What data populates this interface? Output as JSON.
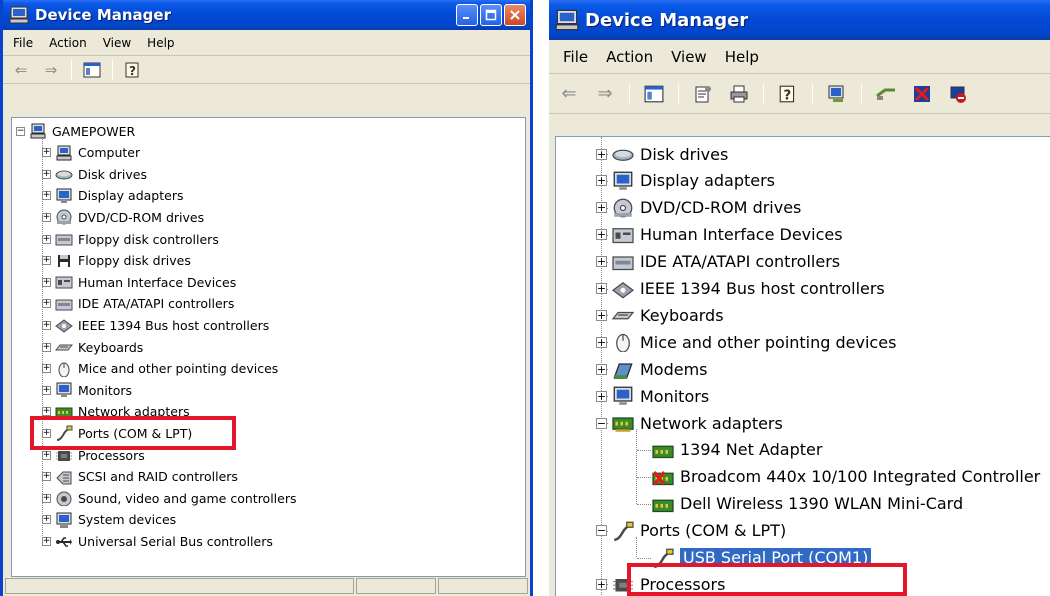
{
  "left_window": {
    "title": "Device Manager",
    "menu": [
      "File",
      "Action",
      "View",
      "Help"
    ],
    "root": "GAMEPOWER",
    "items": [
      {
        "label": "Computer",
        "icon": "computer-icon"
      },
      {
        "label": "Disk drives",
        "icon": "disk-drive-icon"
      },
      {
        "label": "Display adapters",
        "icon": "monitor-icon"
      },
      {
        "label": "DVD/CD-ROM drives",
        "icon": "cd-rom-icon"
      },
      {
        "label": "Floppy disk controllers",
        "icon": "floppy-controller-icon"
      },
      {
        "label": "Floppy disk drives",
        "icon": "floppy-drive-icon"
      },
      {
        "label": "Human Interface Devices",
        "icon": "hid-icon"
      },
      {
        "label": "IDE ATA/ATAPI controllers",
        "icon": "ide-controller-icon"
      },
      {
        "label": "IEEE 1394 Bus host controllers",
        "icon": "ieee1394-icon"
      },
      {
        "label": "Keyboards",
        "icon": "keyboard-icon"
      },
      {
        "label": "Mice and other pointing devices",
        "icon": "mouse-icon"
      },
      {
        "label": "Monitors",
        "icon": "monitor-icon"
      },
      {
        "label": "Network adapters",
        "icon": "network-adapter-icon"
      },
      {
        "label": "Ports (COM & LPT)",
        "icon": "port-icon"
      },
      {
        "label": "Processors",
        "icon": "processor-icon"
      },
      {
        "label": "SCSI and RAID controllers",
        "icon": "scsi-icon"
      },
      {
        "label": "Sound, video and game controllers",
        "icon": "sound-icon"
      },
      {
        "label": "System devices",
        "icon": "system-device-icon"
      },
      {
        "label": "Universal Serial Bus controllers",
        "icon": "usb-icon"
      }
    ]
  },
  "right_window": {
    "title": "Device Manager",
    "menu": [
      "File",
      "Action",
      "View",
      "Help"
    ],
    "items": [
      {
        "label": "Disk drives",
        "icon": "disk-drive-icon",
        "expanded": false
      },
      {
        "label": "Display adapters",
        "icon": "monitor-icon",
        "expanded": false
      },
      {
        "label": "DVD/CD-ROM drives",
        "icon": "cd-rom-icon",
        "expanded": false
      },
      {
        "label": "Human Interface Devices",
        "icon": "hid-icon",
        "expanded": false
      },
      {
        "label": "IDE ATA/ATAPI controllers",
        "icon": "ide-controller-icon",
        "expanded": false
      },
      {
        "label": "IEEE 1394 Bus host controllers",
        "icon": "ieee1394-icon",
        "expanded": false
      },
      {
        "label": "Keyboards",
        "icon": "keyboard-icon",
        "expanded": false
      },
      {
        "label": "Mice and other pointing devices",
        "icon": "mouse-icon",
        "expanded": false
      },
      {
        "label": "Modems",
        "icon": "modem-icon",
        "expanded": false
      },
      {
        "label": "Monitors",
        "icon": "monitor-icon",
        "expanded": false
      },
      {
        "label": "Network adapters",
        "icon": "network-adapter-icon",
        "expanded": true,
        "children": [
          "1394 Net Adapter",
          "Broadcom 440x 10/100 Integrated Controller",
          "Dell Wireless 1390 WLAN Mini-Card"
        ]
      },
      {
        "label": "Ports (COM & LPT)",
        "icon": "port-icon",
        "expanded": true,
        "children": [
          "USB Serial Port (COM1)"
        ]
      },
      {
        "label": "Processors",
        "icon": "processor-icon",
        "expanded": false
      }
    ]
  },
  "colors": {
    "title_bar": "#0249d4",
    "highlight": "#e6162a",
    "selection": "#316ac5"
  }
}
